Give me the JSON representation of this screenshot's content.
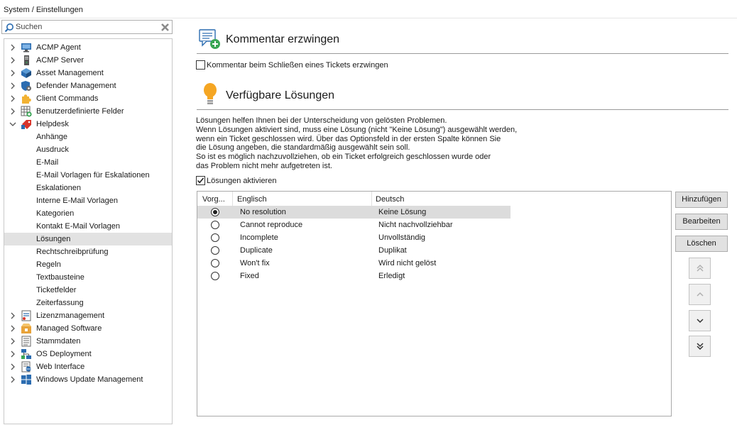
{
  "breadcrumb": "System / Einstellungen",
  "search": {
    "placeholder": "Suchen"
  },
  "tree": {
    "top_a": [
      {
        "label": "ACMP Agent",
        "icon": "monitor-icon"
      },
      {
        "label": "ACMP Server",
        "icon": "server-icon"
      },
      {
        "label": "Asset Management",
        "icon": "cube-icon"
      },
      {
        "label": "Defender Management",
        "icon": "shield-gear-icon"
      },
      {
        "label": "Client Commands",
        "icon": "puzzle-icon"
      },
      {
        "label": "Benutzerdefinierte Felder",
        "icon": "table-add-icon"
      },
      {
        "label": "Helpdesk",
        "icon": "helpdesk-tag-icon"
      }
    ],
    "helpdesk_children": [
      "Anhänge",
      "Ausdruck",
      "E-Mail",
      "E-Mail Vorlagen für Eskalationen",
      "Eskalationen",
      "Interne E-Mail Vorlagen",
      "Kategorien",
      "Kontakt E-Mail Vorlagen",
      "Lösungen",
      "Rechtschreibprüfung",
      "Regeln",
      "Textbausteine",
      "Ticketfelder",
      "Zeiterfassung"
    ],
    "selected_child": "Lösungen",
    "top_b": [
      {
        "label": "Lizenzmanagement",
        "icon": "license-icon"
      },
      {
        "label": "Managed Software",
        "icon": "software-box-icon"
      },
      {
        "label": "Stammdaten",
        "icon": "list-doc-icon"
      },
      {
        "label": "OS Deployment",
        "icon": "network-icon"
      },
      {
        "label": "Web Interface",
        "icon": "web-doc-icon"
      },
      {
        "label": "Windows Update Management",
        "icon": "windows-icon"
      }
    ]
  },
  "comment_section": {
    "title": "Kommentar erzwingen",
    "checkbox_label": "Kommentar beim Schließen eines Tickets erzwingen",
    "checked": false
  },
  "solutions_section": {
    "title": "Verfügbare Lösungen",
    "description": [
      "Lösungen helfen Ihnen bei der Unterscheidung von gelösten Problemen.",
      "Wenn Lösungen aktiviert sind, muss eine Lösung (nicht \"Keine Lösung\") ausgewählt werden,",
      "wenn ein Ticket geschlossen wird. Über das Optionsfeld in der ersten Spalte können Sie",
      "die Lösung angeben, die standardmäßig ausgewählt sein soll.",
      "So ist es möglich nachzuvollziehen, ob ein Ticket erfolgreich geschlossen wurde oder",
      "das Problem nicht mehr aufgetreten ist."
    ],
    "enable_label": "Lösungen aktivieren",
    "enabled": true,
    "columns": [
      "Vorg...",
      "Englisch",
      "Deutsch"
    ],
    "rows": [
      {
        "default": true,
        "en": "No resolution",
        "de": "Keine Lösung"
      },
      {
        "default": false,
        "en": "Cannot reproduce",
        "de": "Nicht nachvollziehbar"
      },
      {
        "default": false,
        "en": "Incomplete",
        "de": "Unvollständig"
      },
      {
        "default": false,
        "en": "Duplicate",
        "de": "Duplikat"
      },
      {
        "default": false,
        "en": "Won't fix",
        "de": "Wird nicht gelöst"
      },
      {
        "default": false,
        "en": "Fixed",
        "de": "Erledigt"
      }
    ]
  },
  "buttons": {
    "add": "Hinzufügen",
    "edit": "Bearbeiten",
    "delete": "Löschen"
  },
  "colors": {
    "accent_green": "#3aa655",
    "icon_blue": "#2b6cb0",
    "bulb_orange": "#f5a623"
  }
}
